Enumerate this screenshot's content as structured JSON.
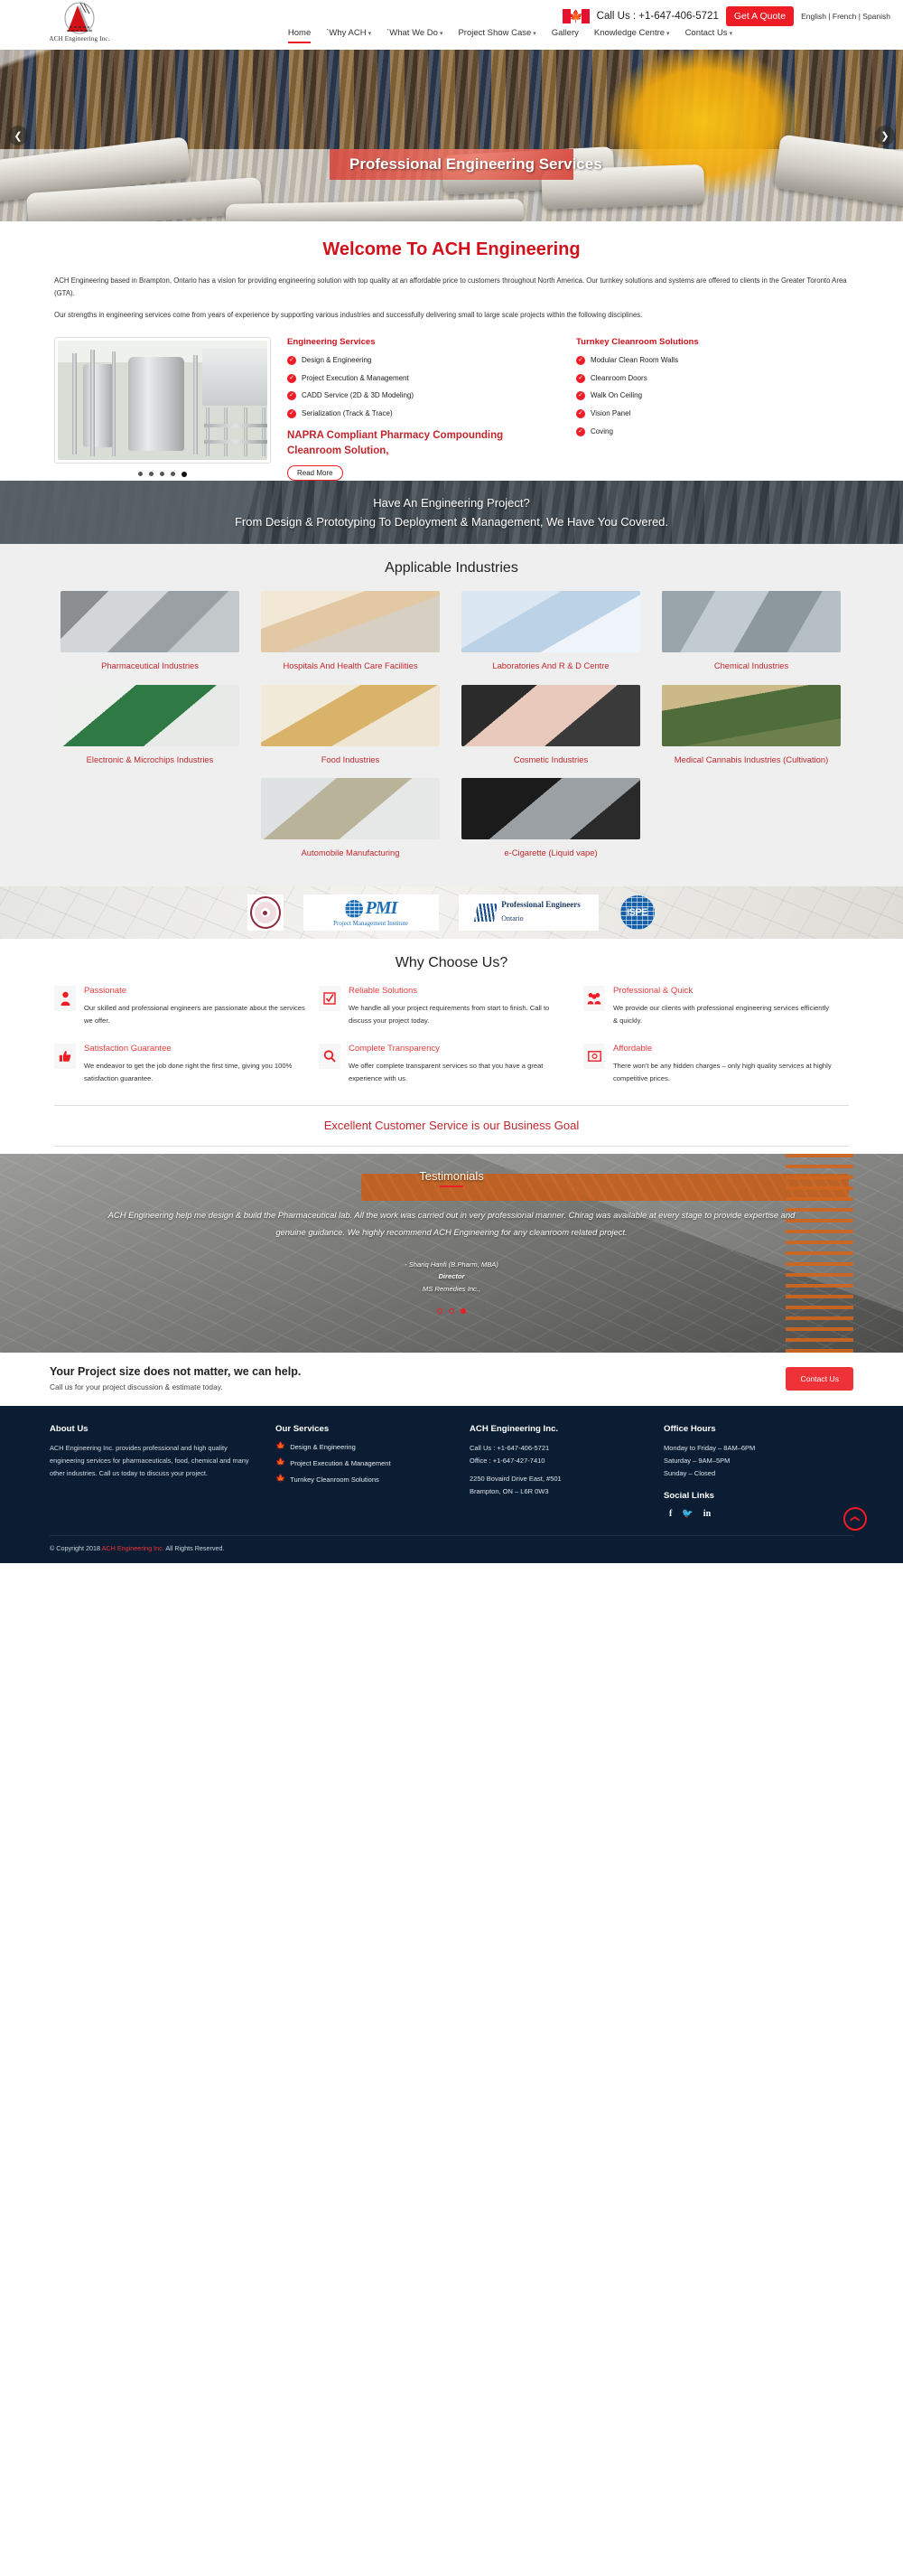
{
  "header": {
    "logo_name": "ACH Engineering Inc.",
    "call_us": "Call Us : +1-647-406-5721",
    "quote_label": "Get A Quote",
    "languages": "English | French | Spanish",
    "nav": [
      {
        "label": "Home",
        "caret": false,
        "active": true
      },
      {
        "label": "`Why ACH",
        "caret": true,
        "active": false
      },
      {
        "label": "`What We Do",
        "caret": true,
        "active": false
      },
      {
        "label": "Project Show Case",
        "caret": true,
        "active": false
      },
      {
        "label": "Gallery",
        "caret": false,
        "active": false
      },
      {
        "label": "Knowledge Centre",
        "caret": true,
        "active": false
      },
      {
        "label": "Contact Us",
        "caret": true,
        "active": false
      }
    ]
  },
  "hero": {
    "title": "Professional Engineering Services",
    "prev_icon": "chevron-left-icon",
    "next_icon": "chevron-right-icon"
  },
  "welcome": {
    "heading": "Welcome To ACH Engineering",
    "para1": "ACH Engineering based in Brampton, Ontario has a vision for providing engineering solution with top quality at an affordable price to customers throughout North America. Our turnkey solutions and systems are offered to clients in the Greater Toronto Area (GTA).",
    "para2": "Our strengths in engineering services come from years of experience by supporting various industries and successfully delivering small to large scale projects within the following disciplines.",
    "carousel_dots": 5,
    "carousel_active": 4,
    "col1_title": "Engineering Services",
    "col1_items": [
      "Design & Engineering",
      "Project Execution & Management",
      "CADD Service (2D & 3D Modeling)",
      "Serialization (Track & Trace)"
    ],
    "col2_title": "Turnkey Cleanroom Solutions",
    "col2_items": [
      "Modular Clean Room Walls",
      "Cleanroom Doors",
      "Walk On Ceiling",
      "Vision Panel",
      "Coving"
    ],
    "napra": "NAPRA Compliant Pharmacy Compounding Cleanroom Solution,",
    "read_more": "Read More"
  },
  "cta_band": {
    "line1": "Have An Engineering Project?",
    "line2": "From Design & Prototyping To Deployment & Management, We Have You Covered."
  },
  "industries": {
    "heading": "Applicable Industries",
    "items": [
      {
        "label": "Pharmaceutical Industries",
        "thumb": "t1"
      },
      {
        "label": "Hospitals And Health Care Facilities",
        "thumb": "t2"
      },
      {
        "label": "Laboratories And R & D Centre",
        "thumb": "t3"
      },
      {
        "label": "Chemical Industries",
        "thumb": "t4"
      },
      {
        "label": "Electronic & Microchips Industries",
        "thumb": "t5"
      },
      {
        "label": "Food Industries",
        "thumb": "t6"
      },
      {
        "label": "Cosmetic Industries",
        "thumb": "t7"
      },
      {
        "label": "Medical Cannabis Industries (Cultivation)",
        "thumb": "t8"
      },
      {
        "label": "Automobile Manufacturing",
        "thumb": "t9"
      },
      {
        "label": "e-Cigarette (Liquid vape)",
        "thumb": "t10"
      }
    ]
  },
  "logos": {
    "items": [
      {
        "name": "association-seal-logo",
        "text": ""
      },
      {
        "name": "pmi-logo",
        "text": "PMI",
        "sub": "Project Management Institute"
      },
      {
        "name": "professional-engineers-ontario-logo",
        "text": "Professional Engineers",
        "sub": "Ontario"
      },
      {
        "name": "ispe-logo",
        "text": "ISPE"
      }
    ]
  },
  "why": {
    "heading": "Why Choose Us?",
    "items": [
      {
        "icon": "person-icon",
        "glyph": "♟",
        "title": "Passionate",
        "text": "Our skilled and professional engineers are passionate about the services we offer."
      },
      {
        "icon": "checkbox-icon",
        "glyph": "☑",
        "title": "Reliable Solutions",
        "text": "We handle all your project requirements from start to finish. Call to discuss your project today."
      },
      {
        "icon": "people-group-icon",
        "glyph": "♟♟",
        "title": "Professional & Quick",
        "text": "We provide our clients with professional engineering services efficiently & quickly."
      },
      {
        "icon": "thumbs-up-icon",
        "glyph": "☝",
        "title": "Satisfaction Guarantee",
        "text": "We endeavor to get the job done right the first time, giving you 100% satisfaction guarantee."
      },
      {
        "icon": "magnifier-icon",
        "glyph": "Q",
        "title": "Complete Transparency",
        "text": "We offer complete transparent services so that you have a great experience with us."
      },
      {
        "icon": "money-icon",
        "glyph": "□",
        "title": "Affordable",
        "text": "There won't be any hidden charges – only high quality services at highly competitive prices."
      }
    ],
    "goal": "Excellent Customer Service is our Business Goal"
  },
  "testimonials": {
    "heading": "Testimonials",
    "quote": "ACH Engineering help me design & build the Pharmaceutical lab. All the work was carried out in very professional manner. Chirag was available at every stage to provide expertise and genuine guidance. We highly recommend ACH Engineering for any cleanroom related project.",
    "author": "- Shariq Hanfi (B.Pharm, MBA)",
    "role": "Director",
    "company": "MS Remedies Inc.,",
    "dots": 3,
    "active": 2
  },
  "contact_cta": {
    "title": "Your Project size does not matter, we can help.",
    "subtitle": "Call us for your project discussion & estimate today.",
    "button": "Contact Us"
  },
  "footer": {
    "about_title": "About Us",
    "about_text": "ACH Engineering Inc. provides professional and high quality engineering services for pharmaceuticals, food, chemical and many other industries. Call us today to discuss your project.",
    "services_title": "Our Services",
    "services": [
      "Design & Engineering",
      "Project Execution & Management",
      "Turnkey Cleanroom Solutions"
    ],
    "company_title": "ACH Engineering Inc.",
    "call": "Call Us : +1-647-406-5721",
    "office": "Office : +1-647-427-7410",
    "addr1": "2250 Bovaird Drive East, #501",
    "addr2": "Brampton, ON – L6R 0W3",
    "hours_title": "Office Hours",
    "hours": [
      "Monday to Friday – 8AM–6PM",
      "Saturday – 9AM–5PM",
      "Sunday – Closed"
    ],
    "social_title": "Social Links",
    "social": [
      "f",
      "ᵛ",
      "in"
    ],
    "copy_pre": "© Copyright 2018 ",
    "copy_link": "ACH Engineering Inc.",
    "copy_post": " All Rights Reserved.",
    "to_top_icon": "chevron-up-icon"
  }
}
